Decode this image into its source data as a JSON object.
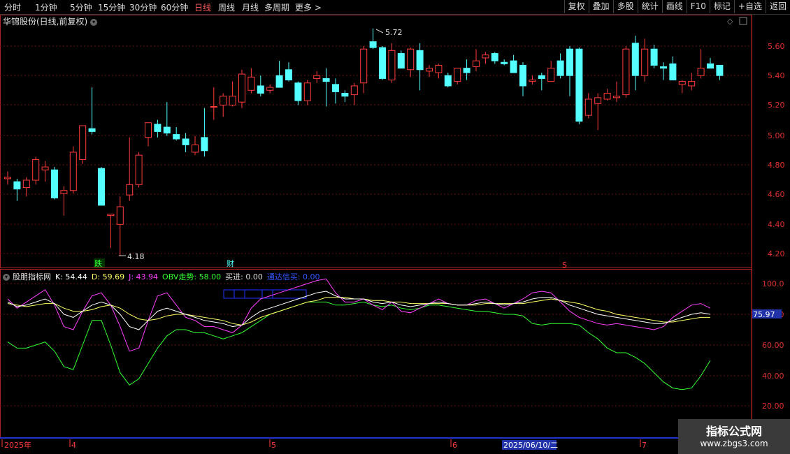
{
  "toolbar": {
    "timeframes": [
      "分时",
      "1分钟",
      "5分钟",
      "15分钟",
      "30分钟",
      "60分钟",
      "日线",
      "周线",
      "月线",
      "多周期",
      "更多 >"
    ],
    "active_timeframe": "日线",
    "tools": [
      "复权",
      "叠加",
      "多股",
      "统计",
      "画线",
      "F10",
      "标记",
      "+自选",
      "返回"
    ]
  },
  "chart_title": "华锦股份(日线,前复权)",
  "price_axis": [
    "5.60",
    "5.40",
    "5.20",
    "5.00",
    "4.80",
    "4.60",
    "4.40",
    "4.20"
  ],
  "price_markers": {
    "high": "5.72",
    "low": "4.18"
  },
  "event_labels": {
    "die": "跌",
    "cai": "财",
    "s": "S"
  },
  "indicator": {
    "name": "股朋指标网",
    "k": "K: 54.44",
    "d": "D: 59.69",
    "j": "J: 43.94",
    "obv": "OBV走势: 58.00",
    "buy": "买进: 0.00",
    "signal": "通达信买: 0.00",
    "axis": [
      "100.0",
      "80.00",
      "60.00",
      "40.00",
      "20.00"
    ],
    "current_value": "75.97"
  },
  "date_axis": {
    "labels": [
      "2025年",
      "4",
      "5",
      "6",
      "7"
    ],
    "cursor_date": "2025/06/10/二"
  },
  "watermark": {
    "line1": "指标公式网",
    "line2": "www.zbgs3.com"
  },
  "colors": {
    "up": "#ff3c3c",
    "down": "#54ffff",
    "k": "#ffffff",
    "d": "#ffff66",
    "j": "#ff40ff",
    "obv": "#33ff33"
  }
}
